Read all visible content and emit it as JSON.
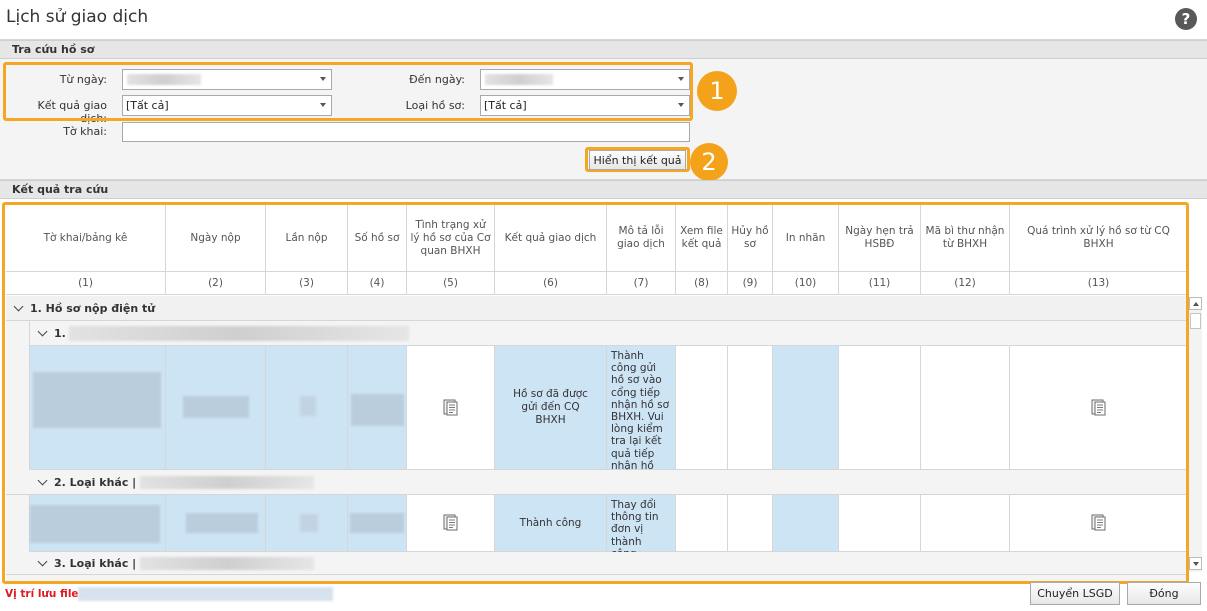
{
  "header": {
    "title": "Lịch sử giao dịch",
    "help_glyph": "?"
  },
  "search": {
    "section_title": "Tra cứu hồ sơ",
    "from_date_label": "Từ ngày:",
    "to_date_label": "Đến ngày:",
    "result_label": "Kết quả giao dịch:",
    "result_value": "[Tất cả]",
    "type_label": "Loại hồ sơ:",
    "type_value": "[Tất cả]",
    "form_label": "Tờ khai:",
    "show_button": "Hiển thị kết quả"
  },
  "annotations": {
    "badge1": "1",
    "badge2": "2"
  },
  "results": {
    "section_title": "Kết quả tra cứu",
    "columns": [
      "Tờ khai/bảng kê",
      "Ngày nộp",
      "Lần nộp",
      "Số hồ sơ",
      "Tình trạng xử lý hồ sơ của Cơ quan BHXH",
      "Kết quả giao dịch",
      "Mô tả lỗi giao dịch",
      "Xem file kết quả",
      "Hủy hồ sơ",
      "In nhãn",
      "Ngày hẹn trả HSBĐ",
      "Mã bì thư nhận từ BHXH",
      "Quá trình xử lý hồ sơ từ CQ BHXH"
    ],
    "column_numbers": [
      "(1)",
      "(2)",
      "(3)",
      "(4)",
      "(5)",
      "(6)",
      "(7)",
      "(8)",
      "(9)",
      "(10)",
      "(11)",
      "(12)",
      "(13)"
    ],
    "group_top": "1. Hồ sơ nộp điện tử",
    "sub1": "1.",
    "row1_result": "Hồ sơ đã được gửi đến CQ BHXH",
    "row1_desc": "Thành công gửi hồ sơ vào cổng tiếp nhận hồ sơ BHXH. Vui lòng kiểm tra lại kết quả tiếp nhận hồ sơ.",
    "sub2": "2. Loại khác |",
    "row2_result": "Thành công",
    "row2_desc": "Thay đổi thông tin đơn vị thành công.",
    "sub3": "3. Loại khác |"
  },
  "footer": {
    "save_location_label": "Vị trí lưu file:",
    "transfer_button": "Chuyển LSGD",
    "close_button": "Đóng"
  },
  "colors": {
    "accent_orange": "#f5a623",
    "selection_blue": "#cde4f5",
    "error_red": "#e0191f"
  }
}
